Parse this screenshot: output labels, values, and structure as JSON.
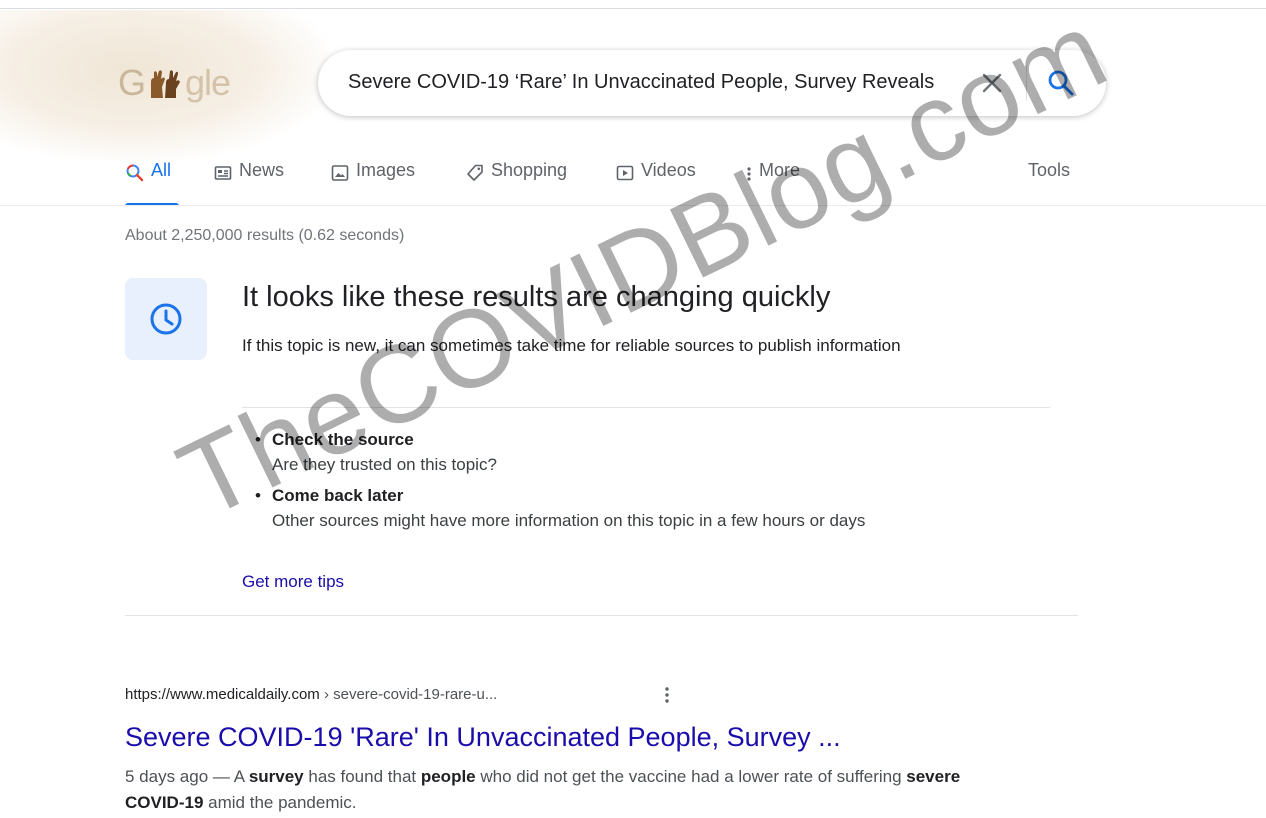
{
  "logo": {
    "prefix": "G",
    "suffix": "gle"
  },
  "search": {
    "query": "Severe COVID-19 ‘Rare’ In Unvaccinated People, Survey Reveals",
    "clear_icon": "close-icon",
    "search_icon": "search-icon"
  },
  "tabs": [
    {
      "label": "All",
      "icon": "search-icon",
      "active": true
    },
    {
      "label": "News",
      "icon": "newspaper-icon"
    },
    {
      "label": "Images",
      "icon": "image-icon"
    },
    {
      "label": "Shopping",
      "icon": "tag-icon"
    },
    {
      "label": "Videos",
      "icon": "play-icon"
    },
    {
      "label": "More",
      "icon": "vertical-dots-icon"
    }
  ],
  "tools_label": "Tools",
  "stats": "About 2,250,000 results (0.62 seconds)",
  "notice": {
    "icon": "clock-icon",
    "title": "It looks like these results are changing quickly",
    "body": "If this topic is new, it can sometimes take time for reliable sources to publish information",
    "tips": [
      {
        "heading": "Check the source",
        "text": "Are they trusted on this topic?"
      },
      {
        "heading": "Come back later",
        "text": "Other sources might have more information on this topic in a few hours or days"
      }
    ],
    "more_link": "Get more tips"
  },
  "result": {
    "domain": "https://www.medicaldaily.com",
    "path": " › severe-covid-19-rare-u...",
    "title": "Severe COVID-19 'Rare' In Unvaccinated People, Survey ...",
    "snippet_date": "5 days ago — ",
    "snippet_1": "A ",
    "snippet_b1": "survey",
    "snippet_2": " has found that ",
    "snippet_b2": "people",
    "snippet_3": " who did not get the vaccine had a lower rate of suffering ",
    "snippet_b3": "severe COVID-19",
    "snippet_4": " amid the pandemic."
  },
  "watermark": "TheCOVIDBlog.com",
  "colors": {
    "accent": "#1a73e8",
    "link": "#1a0dab",
    "notice_bg": "#e8f0fe"
  }
}
